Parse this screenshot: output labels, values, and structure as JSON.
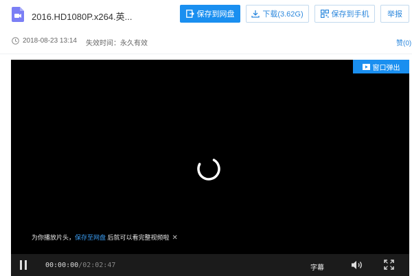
{
  "file": {
    "title": "2016.HD1080P.x264.英...",
    "icon": "video-file-icon"
  },
  "toolbar": {
    "save_label": "保存到网盘",
    "download_label": "下载(3.62G)",
    "phone_label": "保存到手机",
    "report_label": "举报"
  },
  "meta": {
    "date": "2018-08-23 13:14",
    "expiry": "失效时间：永久有效",
    "like_label": "赞(0)"
  },
  "player": {
    "popout_label": "窗口弹出",
    "hint_prefix": "为你播放片头，",
    "hint_link": "保存至网盘",
    "hint_suffix": " 后就可以看完整视频啦",
    "hint_close": "✕",
    "time_current": "00:00:00",
    "time_total": "/02:02:47",
    "subtitle_label": "字幕",
    "state": "loading"
  },
  "colors": {
    "accent": "#1a8ff0",
    "player_bg": "#000000",
    "controls_bg": "#1b1b1b"
  }
}
